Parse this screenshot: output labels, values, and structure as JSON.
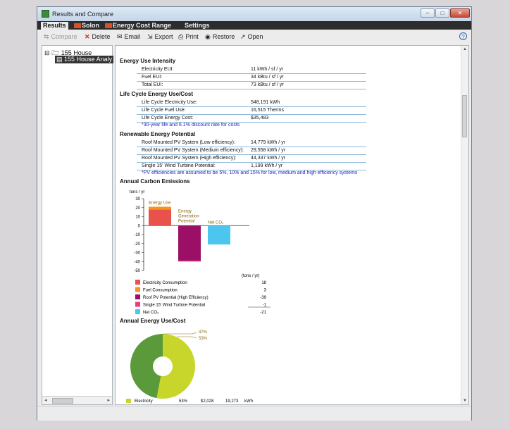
{
  "window": {
    "title": "Results and Compare"
  },
  "window_controls": {
    "minimize": "–",
    "restore": "□",
    "close": "✕"
  },
  "menu": [
    {
      "label": "Results",
      "active": true,
      "tagged": false
    },
    {
      "label": "Solon",
      "active": false,
      "tagged": true
    },
    {
      "label": "Energy  Cost  Range",
      "active": false,
      "tagged": true
    },
    {
      "label": "Settings",
      "active": false,
      "tagged": false
    }
  ],
  "toolbar": {
    "compare": "Compare",
    "delete": "Delete",
    "email": "Email",
    "export": "Export",
    "print": "Print",
    "restore": "Restore",
    "open": "Open",
    "help": "?"
  },
  "tree": {
    "root": "155 House",
    "child": "155 House Analy"
  },
  "sections": {
    "eui": {
      "title": "Energy Use Intensity",
      "rows": [
        {
          "label": "Electricity EUI:",
          "value": "11 kWh / sf / yr"
        },
        {
          "label": "Fuel EUI:",
          "value": "34 kBtu / sf / yr"
        },
        {
          "label": "Total EUI:",
          "value": "73 kBtu / sf / yr"
        }
      ]
    },
    "lcc": {
      "title": "Life Cycle Energy Use/Cost",
      "rows": [
        {
          "label": "Life Cycle Electricity Use:",
          "value": "548,191 kWh"
        },
        {
          "label": "Life Cycle Fuel Use:",
          "value": "16,515 Therms"
        },
        {
          "label": "Life Cycle Energy Cost:",
          "value": "$35,483"
        }
      ],
      "note": "*30-year life and 6.1% discount rate for costs"
    },
    "renew": {
      "title": "Renewable Energy Potential",
      "rows": [
        {
          "label": "Roof Mounted PV System (Low efficiency):",
          "value": "14,779 kWh / yr"
        },
        {
          "label": "Roof Mounted PV System (Medium efficiency):",
          "value": "29,558 kWh / yr"
        },
        {
          "label": "Roof Mounted PV System (High efficiency):",
          "value": "44,337 kWh / yr"
        },
        {
          "label": "Single 15' Wind Turbine Potential:",
          "value": "1,199 kWh / yr"
        }
      ],
      "note": "*PV efficiencies are assumed to be 5%, 10% and 15% for low, medium and high efficiency systems"
    },
    "carbon": {
      "title": "Annual Carbon Emissions"
    },
    "energy_cost": {
      "title": "Annual Energy Use/Cost"
    }
  },
  "chart_data": [
    {
      "type": "bar",
      "ylabel": "tons / yr",
      "ylim": [
        -50,
        30
      ],
      "yticks": [
        30,
        20,
        10,
        0,
        -10,
        -20,
        -30,
        -40,
        -50
      ],
      "bar_labels": [
        "Energy Use",
        "Energy Generation Potential",
        "Net CO₂"
      ],
      "series": [
        {
          "name": "Electricity Consumption",
          "color": "#e8524a",
          "value": 18
        },
        {
          "name": "Fuel Consumption",
          "color": "#f5951f",
          "value": 3
        },
        {
          "name": "Roof PV Potential (High Efficiency)",
          "color": "#9b0f67",
          "value": -39
        },
        {
          "name": "Single 15' Wind Turbine Potential",
          "color": "#ea3b8a",
          "value": -1
        },
        {
          "name": "Net CO₂",
          "color": "#4cc6ee",
          "value": -21
        }
      ],
      "legend_header": "(tons / yr)",
      "legend_values": [
        "18",
        "3",
        "-39",
        "-1",
        "-21"
      ]
    },
    {
      "type": "pie",
      "slices": [
        {
          "name": "Electricity",
          "value": 53,
          "color": "#c8d62b"
        },
        {
          "name": "",
          "value": 47,
          "color": "#5a9a3a"
        }
      ],
      "callouts": [
        "47%",
        "53%"
      ],
      "legend_rows": [
        {
          "name": "Electricity",
          "percent": "53%",
          "cost": "$2,028",
          "amount": "19,273",
          "unit": "kWh"
        }
      ]
    }
  ]
}
